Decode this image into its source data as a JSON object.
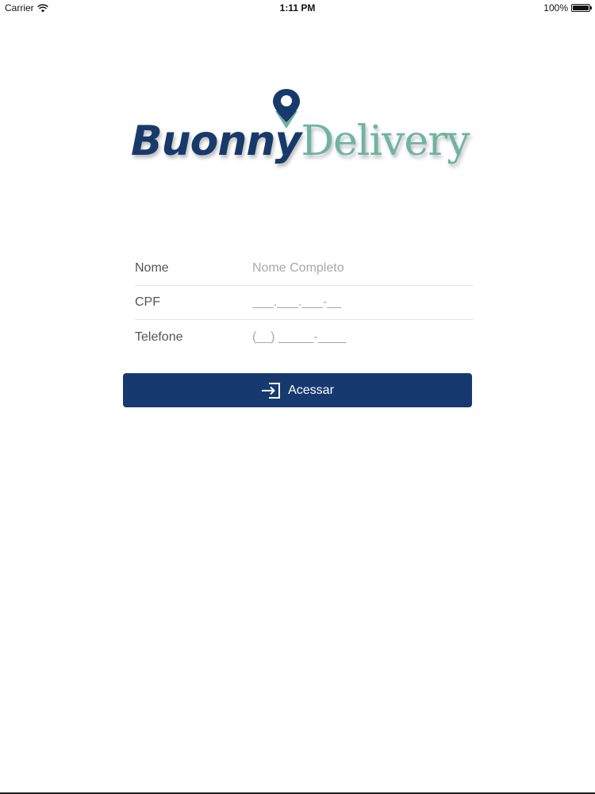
{
  "status_bar": {
    "carrier": "Carrier",
    "time": "1:11 PM",
    "battery_text": "100%",
    "battery_level": 1.0,
    "wifi_icon": "wifi-icon",
    "battery_icon": "battery-icon"
  },
  "logo": {
    "part1": "Buonny",
    "part2": "Delivery",
    "pin_icon": "map-pin-icon",
    "colors": {
      "primary": "#183a6b",
      "secondary": "#6fb3a2"
    }
  },
  "form": {
    "nome": {
      "label": "Nome",
      "placeholder": "Nome Completo",
      "value": ""
    },
    "cpf": {
      "label": "CPF",
      "placeholder": "___.___.___-__",
      "value": ""
    },
    "telefone": {
      "label": "Telefone",
      "placeholder": "(__) _____-____",
      "value": ""
    }
  },
  "button": {
    "label": "Acessar",
    "icon": "login-icon",
    "color": "#163a70"
  }
}
